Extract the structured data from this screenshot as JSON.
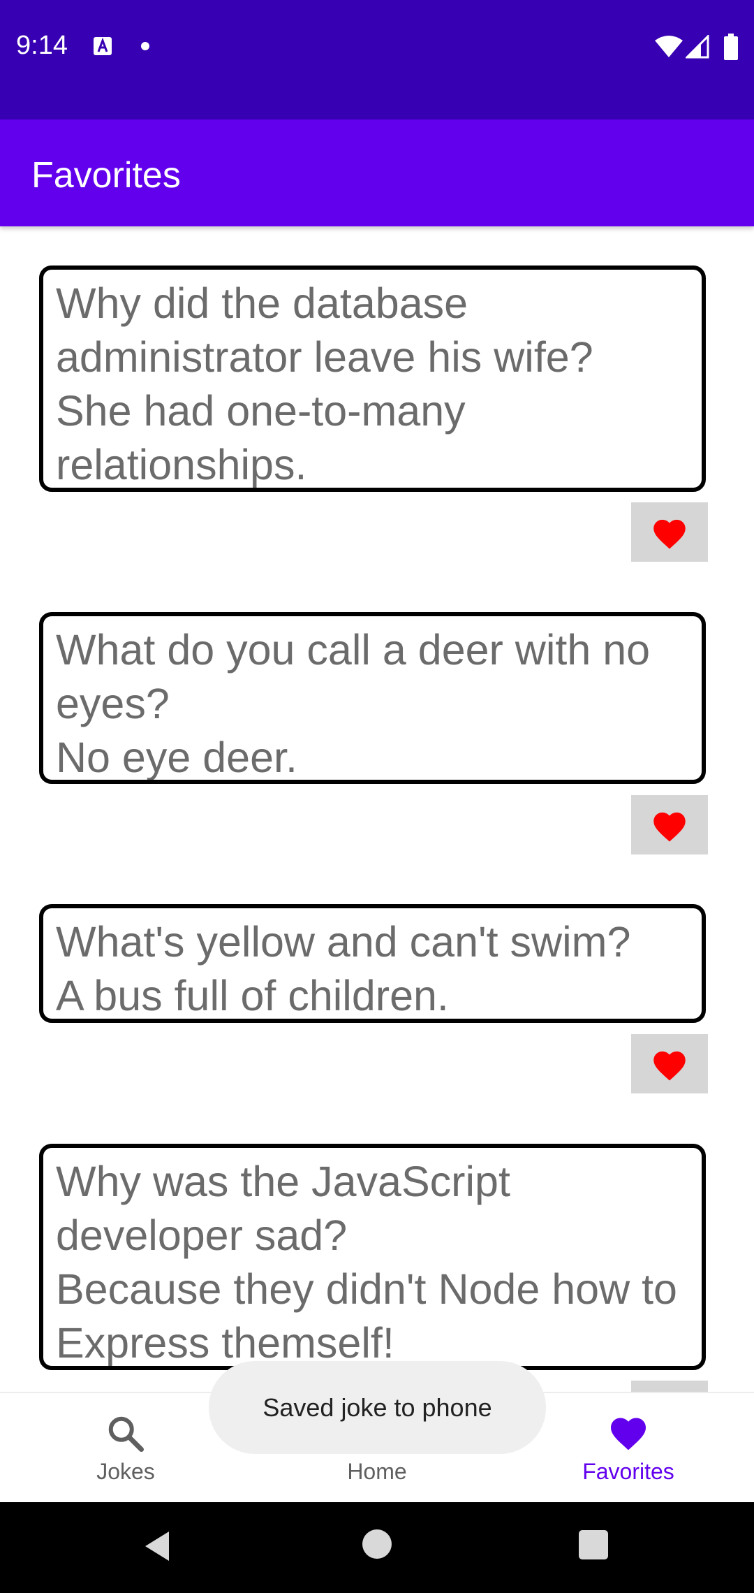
{
  "status_bar": {
    "time": "9:14",
    "notification_icons": [
      "text-a-icon",
      "dot-icon"
    ],
    "system_icons": [
      "wifi-icon",
      "signal-icon",
      "battery-icon"
    ]
  },
  "app_bar": {
    "title": "Favorites",
    "color": "#6200ee"
  },
  "jokes": [
    {
      "text": "Why did the database administrator leave his wife?\nShe had one-to-many relationships.",
      "favorited": true
    },
    {
      "text": "What do you call a deer with no eyes?\nNo eye deer.",
      "favorited": true
    },
    {
      "text": "What's yellow and can't swim?\nA bus full of children.",
      "favorited": true
    },
    {
      "text": "Why was the JavaScript developer sad?\nBecause they didn't Node how to Express themself!",
      "favorited": true
    }
  ],
  "toast": {
    "message": "Saved joke to phone"
  },
  "bottom_nav": {
    "items": [
      {
        "label": "Jokes",
        "icon": "search-icon",
        "active": false
      },
      {
        "label": "Home",
        "icon": "home-icon",
        "active": false
      },
      {
        "label": "Favorites",
        "icon": "heart-icon",
        "active": true
      }
    ],
    "active_color": "#6200ee"
  },
  "colors": {
    "status_bar": "#3700b3",
    "heart": "#ff0000",
    "fav_button_bg": "#d6d6d6"
  }
}
